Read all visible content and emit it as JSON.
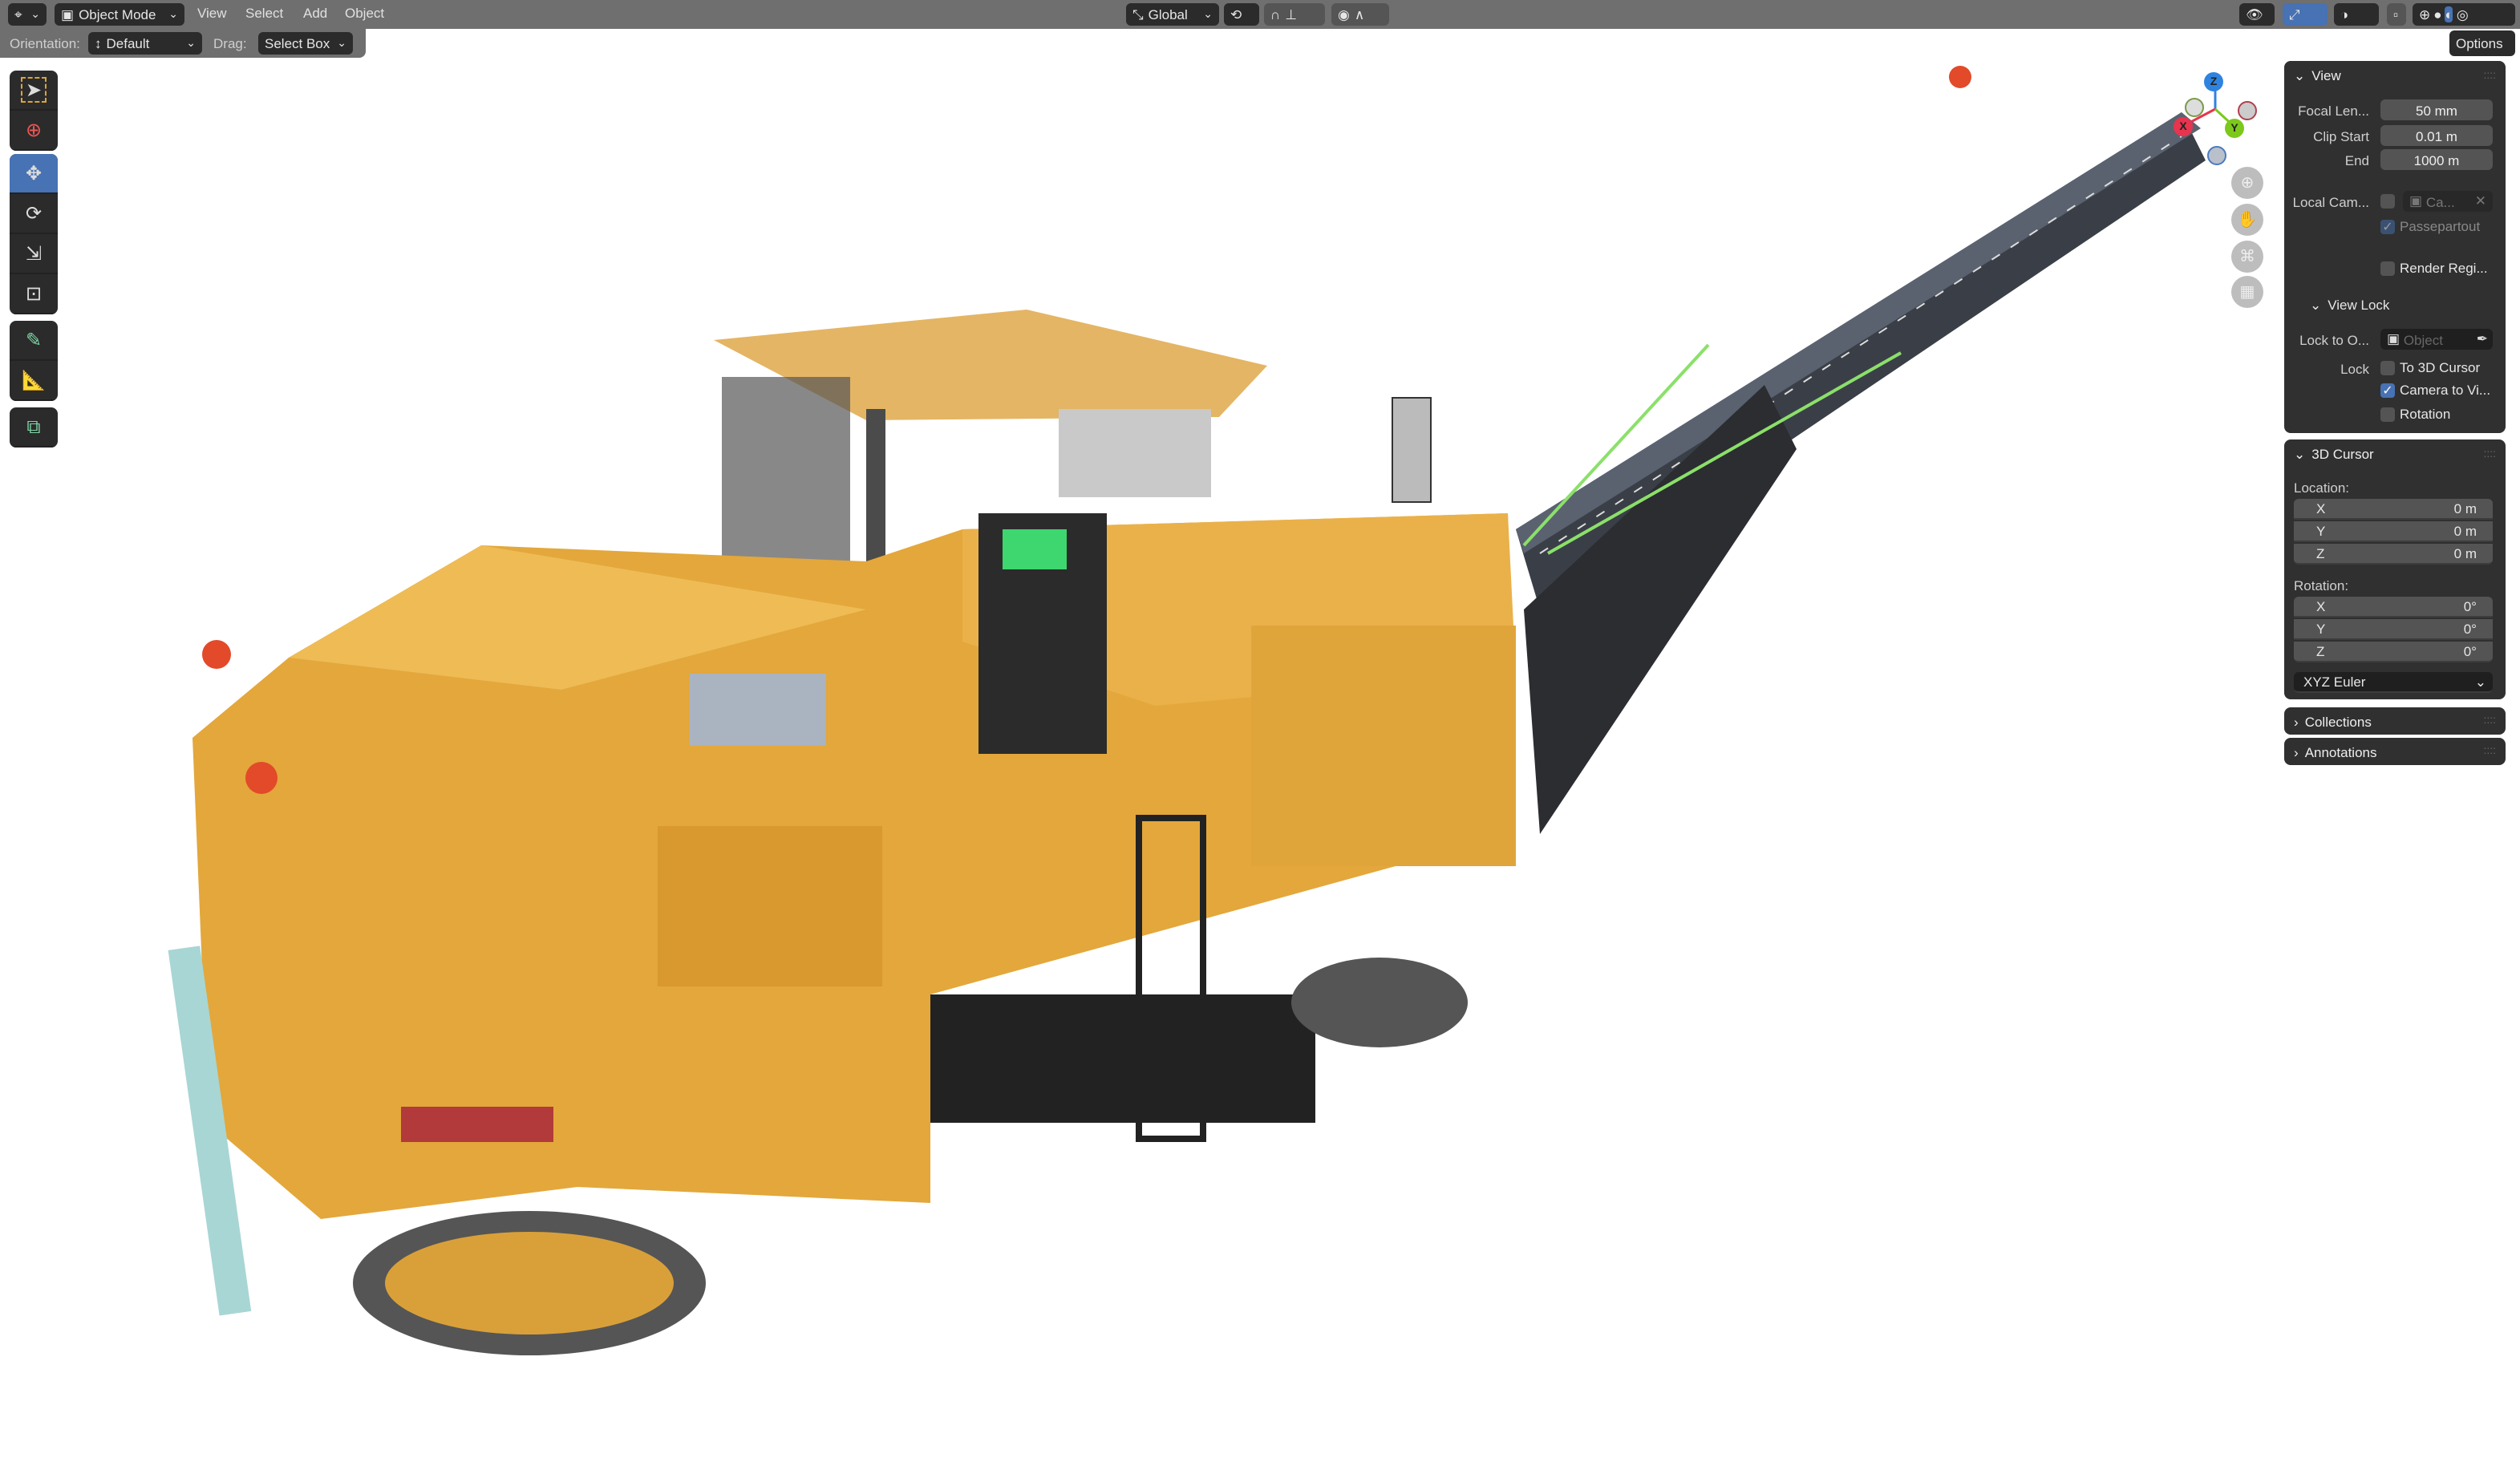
{
  "header": {
    "mode": "Object Mode",
    "menus": [
      "View",
      "Select",
      "Add",
      "Object"
    ],
    "transform_orientation": "Global",
    "options_label": "Options"
  },
  "tool_settings": {
    "orientation_label": "Orientation:",
    "orientation_value": "Default",
    "drag_label": "Drag:",
    "drag_value": "Select Box"
  },
  "toolbar": [
    "select-box",
    "cursor",
    "move",
    "rotate",
    "scale",
    "transform",
    "annotate",
    "measure",
    "add-cube"
  ],
  "gizmo": {
    "x": "X",
    "y": "Y",
    "z": "Z",
    "colors": {
      "x": "#e8344e",
      "y": "#7cc81c",
      "z": "#2f83e0"
    }
  },
  "sidebar": {
    "view": {
      "title": "View",
      "focal_label": "Focal Len...",
      "focal_value": "50 mm",
      "clip_start_label": "Clip Start",
      "clip_start_value": "0.01 m",
      "clip_end_label": "End",
      "clip_end_value": "1000 m",
      "local_camera_label": "Local Cam...",
      "local_camera_value": "Ca...",
      "passepartout_label": "Passepartout",
      "render_region_label": "Render Regi...",
      "view_lock_title": "View Lock",
      "lock_object_label": "Lock to O...",
      "lock_object_placeholder": "Object",
      "lock_label": "Lock",
      "to_3d_cursor_label": "To 3D Cursor",
      "camera_to_view_label": "Camera to Vi...",
      "rotation_label": "Rotation"
    },
    "cursor": {
      "title": "3D Cursor",
      "location_label": "Location:",
      "location": [
        {
          "axis": "X",
          "value": "0 m"
        },
        {
          "axis": "Y",
          "value": "0 m"
        },
        {
          "axis": "Z",
          "value": "0 m"
        }
      ],
      "rotation_label": "Rotation:",
      "rotation": [
        {
          "axis": "X",
          "value": "0°"
        },
        {
          "axis": "Y",
          "value": "0°"
        },
        {
          "axis": "Z",
          "value": "0°"
        }
      ],
      "rotation_mode": "XYZ Euler"
    },
    "collections_title": "Collections",
    "annotations_title": "Annotations"
  }
}
